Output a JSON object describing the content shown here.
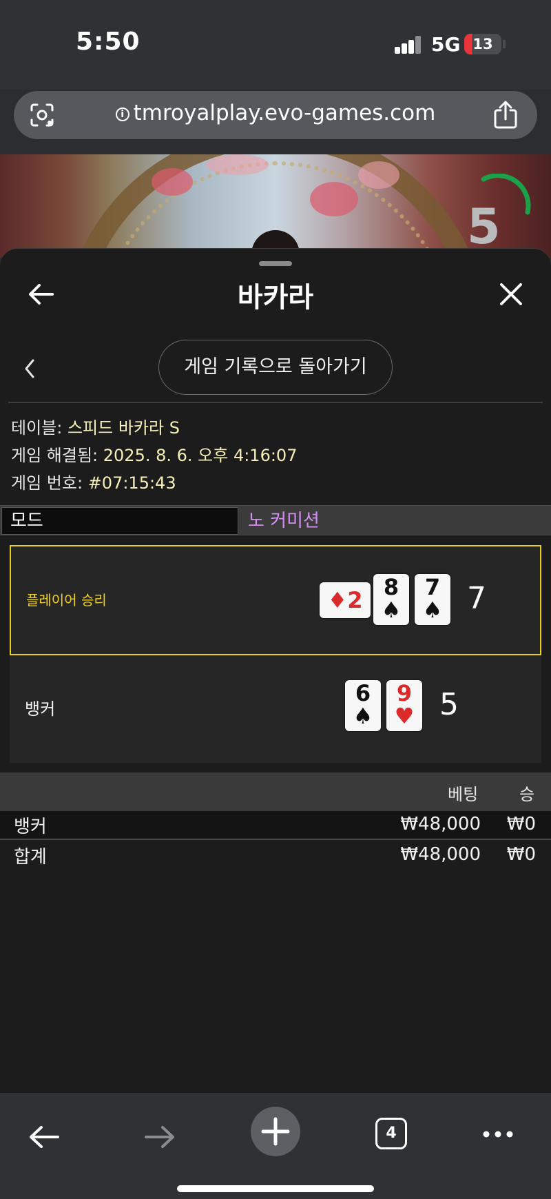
{
  "status": {
    "time": "5:50",
    "network": "5G",
    "battery": "13"
  },
  "browser": {
    "url": "tmroyalplay.evo-games.com",
    "open_tabs": "4"
  },
  "video": {
    "timer": "5"
  },
  "sheet": {
    "title": "바카라",
    "back_to_history": "게임 기록으로 돌아가기",
    "info": {
      "table_label": "테이블:",
      "table_value": "스피드 바카라 S",
      "resolved_label": "게임 해결됨:",
      "resolved_value": "2025. 8. 6. 오후 4:16:07",
      "game_no_label": "게임 번호:",
      "game_no_value": "#07:15:43"
    },
    "mode": {
      "label": "모드",
      "value": "노 커미션"
    },
    "result": {
      "player": {
        "label": "플레이어 승리",
        "score": "7",
        "cards": [
          {
            "rank": "2",
            "suit": "♦",
            "color": "red"
          },
          {
            "rank": "8",
            "suit": "♠",
            "color": "black"
          },
          {
            "rank": "7",
            "suit": "♠",
            "color": "black"
          }
        ]
      },
      "banker": {
        "label": "뱅커",
        "score": "5",
        "cards": [
          {
            "rank": "6",
            "suit": "♠",
            "color": "black"
          },
          {
            "rank": "9",
            "suit": "♥",
            "color": "red"
          }
        ]
      }
    },
    "bets": {
      "header_bet": "베팅",
      "header_win": "승",
      "rows": [
        {
          "label": "뱅커",
          "bet": "₩48,000",
          "win": "₩0"
        }
      ],
      "total": {
        "label": "합계",
        "bet": "₩48,000",
        "win": "₩0"
      }
    }
  },
  "colors": {
    "winner_highlight": "#e7cf1e",
    "mode_value": "#d78ef2",
    "timer_arc": "#1aa14a",
    "battery_low": "#e8353b"
  }
}
